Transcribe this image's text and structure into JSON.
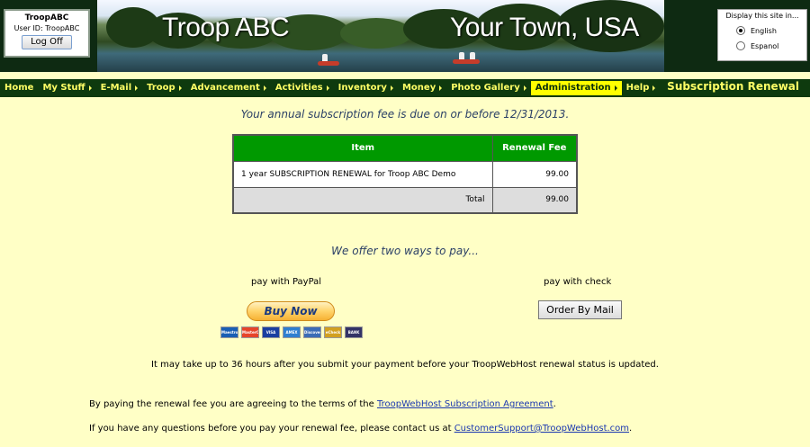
{
  "header": {
    "title_left": "Troop ABC",
    "title_right": "Your Town, USA"
  },
  "login": {
    "user_name": "TroopABC",
    "user_id_label": "User ID:",
    "user_id": "TroopABC",
    "logoff_label": "Log Off"
  },
  "language": {
    "title": "Display this site in...",
    "options": [
      {
        "label": "English",
        "selected": true
      },
      {
        "label": "Espanol",
        "selected": false
      }
    ]
  },
  "nav": {
    "items": [
      {
        "label": "Home",
        "arrow": false,
        "active": false
      },
      {
        "label": "My Stuff",
        "arrow": true,
        "active": false
      },
      {
        "label": "E-Mail",
        "arrow": true,
        "active": false
      },
      {
        "label": "Troop",
        "arrow": true,
        "active": false
      },
      {
        "label": "Advancement",
        "arrow": true,
        "active": false
      },
      {
        "label": "Activities",
        "arrow": true,
        "active": false
      },
      {
        "label": "Inventory",
        "arrow": true,
        "active": false
      },
      {
        "label": "Money",
        "arrow": true,
        "active": false
      },
      {
        "label": "Photo Gallery",
        "arrow": true,
        "active": false
      },
      {
        "label": "Administration",
        "arrow": true,
        "active": true
      },
      {
        "label": "Help",
        "arrow": true,
        "active": false
      }
    ],
    "page_title": "Subscription Renewal"
  },
  "main": {
    "due_notice": "Your annual subscription fee is due on or before 12/31/2013.",
    "table": {
      "headers": [
        "Item",
        "Renewal Fee"
      ],
      "rows": [
        {
          "item": "1 year SUBSCRIPTION RENEWAL for Troop ABC Demo",
          "fee": "99.00"
        }
      ],
      "total_label": "Total",
      "total_value": "99.00"
    },
    "offer": "We offer two ways to pay...",
    "paypal_label": "pay with PayPal",
    "check_label": "pay with check",
    "buynow_label": "Buy Now",
    "order_by_mail_label": "Order By Mail",
    "cards": [
      {
        "label": "Maestro",
        "color": "#1a5fb4"
      },
      {
        "label": "MasterCard",
        "color": "#e6452b"
      },
      {
        "label": "VISA",
        "color": "#1b3fa0"
      },
      {
        "label": "AMEX",
        "color": "#2f7fd0"
      },
      {
        "label": "Discover",
        "color": "#3c6db6"
      },
      {
        "label": "eCheck",
        "color": "#d2a020"
      },
      {
        "label": "BANK",
        "color": "#333366"
      }
    ],
    "processing_note": "It may take up to 36 hours after you submit your payment before your TroopWebHost renewal status is updated.",
    "terms_prefix": "By paying the renewal fee you are agreeing to the terms of the ",
    "terms_link": "TroopWebHost Subscription Agreement",
    "terms_suffix": ".",
    "contact_prefix": "If you have any questions before you pay your renewal fee, please contact us at ",
    "contact_link": "CustomerSupport@TroopWebHost.com",
    "contact_suffix": "."
  }
}
